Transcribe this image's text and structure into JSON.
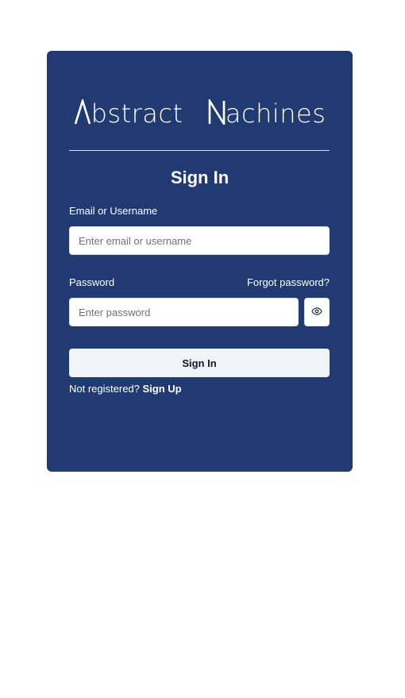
{
  "brand": {
    "logo_first_word_rest": "bstract",
    "logo_second_word_rest": "achines"
  },
  "form": {
    "title": "Sign In",
    "email_label": "Email or Username",
    "email_placeholder": "Enter email or username",
    "email_value": "",
    "password_label": "Password",
    "forgot_password_label": "Forgot password?",
    "password_placeholder": "Enter password",
    "password_value": "",
    "show_password_icon": "eye-icon",
    "submit_label": "Sign In",
    "signup_prompt": "Not registered?",
    "signup_link_label": "Sign Up"
  },
  "colors": {
    "card_background": "#223a72",
    "button_background": "#f0f3f8",
    "page_background": "#ffffff"
  }
}
